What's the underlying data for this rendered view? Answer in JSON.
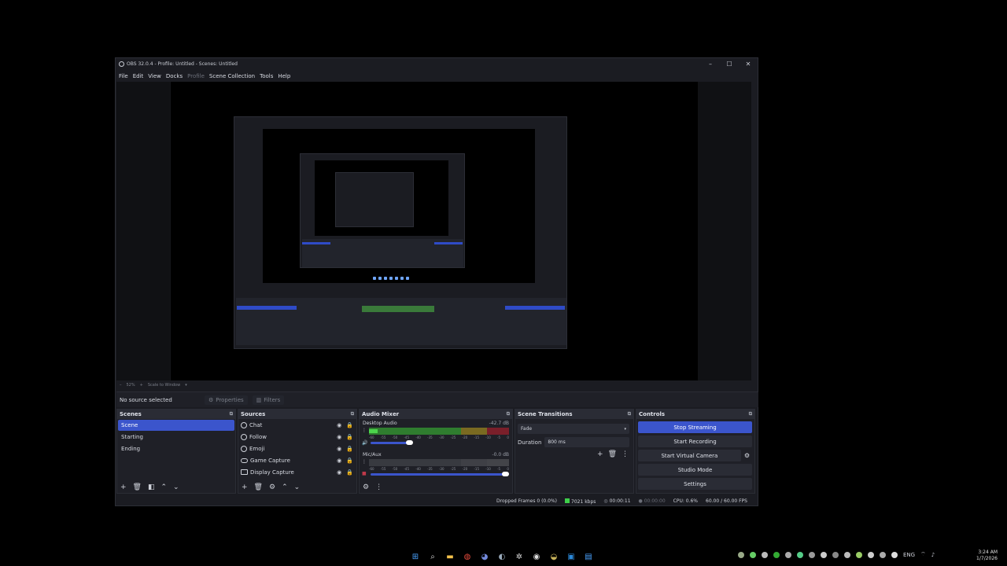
{
  "window": {
    "title": "OBS 32.0.4 - Profile: Untitled - Scenes: Untitled",
    "min": "–",
    "max": "☐",
    "close": "✕"
  },
  "menu": {
    "items": [
      "File",
      "Edit",
      "View",
      "Docks",
      "Profile",
      "Scene Collection",
      "Tools",
      "Help"
    ]
  },
  "zoom": {
    "minus": "–",
    "value": "52%",
    "plus": "+",
    "mode": "Scale to Window"
  },
  "source_bar": {
    "status": "No source selected",
    "properties": "Properties",
    "filters": "Filters"
  },
  "scenes": {
    "title": "Scenes",
    "items": [
      "Scene",
      "Starting",
      "Ending"
    ],
    "active_index": 0
  },
  "sources": {
    "title": "Sources",
    "items": [
      "Chat",
      "Follow",
      "Emoji",
      "Game Capture",
      "Display Capture"
    ]
  },
  "mixer": {
    "title": "Audio Mixer",
    "channels": [
      {
        "name": "Desktop Audio",
        "db": "-42.7 dB",
        "level": 0.06
      },
      {
        "name": "Mic/Aux",
        "db": "-0.0 dB",
        "level": 0.0
      }
    ],
    "ticks": [
      "-60",
      "-55",
      "-50",
      "-45",
      "-40",
      "-35",
      "-30",
      "-25",
      "-20",
      "-15",
      "-10",
      "-5",
      "0"
    ]
  },
  "transitions": {
    "title": "Scene Transitions",
    "selected": "Fade",
    "duration_label": "Duration",
    "duration_value": "800 ms"
  },
  "controls": {
    "title": "Controls",
    "stop_streaming": "Stop Streaming",
    "start_recording": "Start Recording",
    "start_virtual_camera": "Start Virtual Camera",
    "studio_mode": "Studio Mode",
    "settings": "Settings"
  },
  "status": {
    "dropped": "Dropped Frames 0 (0.0%)",
    "bitrate": "7021 kbps",
    "stream_time": "00:00:11",
    "rec_time": "00:00:00",
    "cpu": "CPU: 0.6%",
    "fps": "60.00 / 60.00 FPS"
  },
  "clock": {
    "time": "3:24 AM",
    "date": "1/7/2026"
  },
  "tray": {
    "lang": "ENG"
  }
}
